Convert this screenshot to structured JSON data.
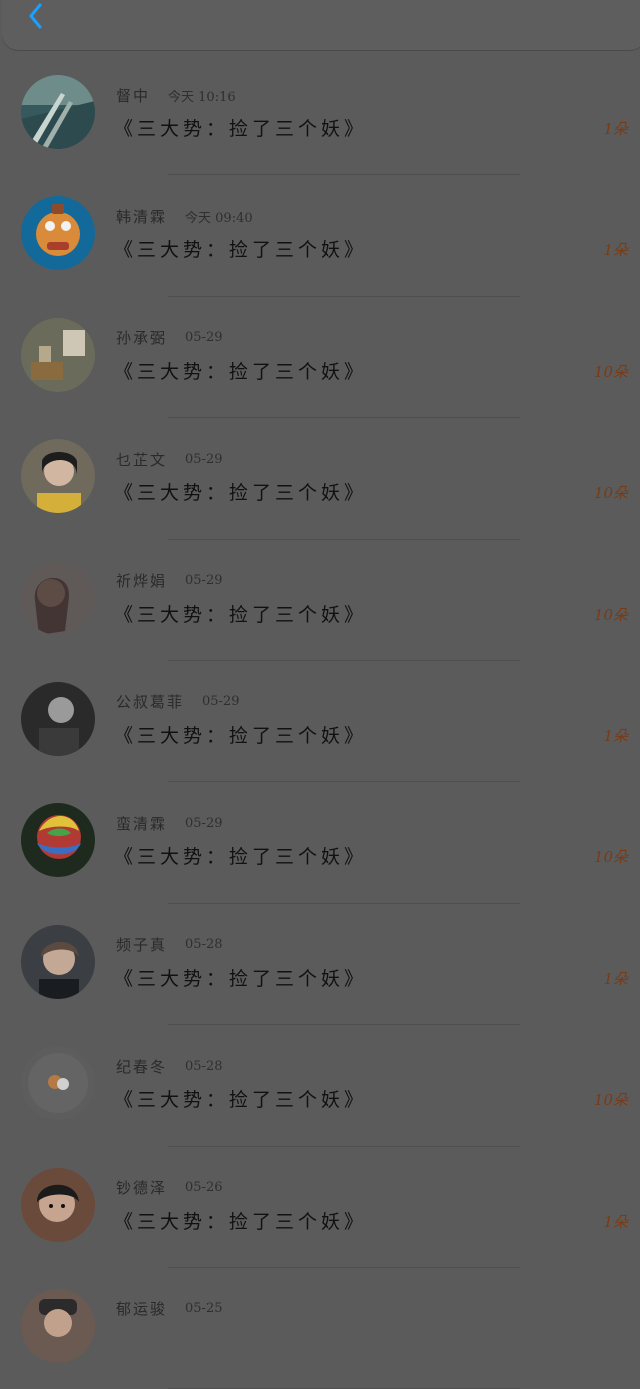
{
  "header": {
    "back_icon": "chevron-left-icon"
  },
  "accent_color": "#1aa1ff",
  "count_color": "#7a3b14",
  "items": [
    {
      "name": "督中",
      "time": "今天 10:16",
      "title": "《三大势：捡了三个妖》",
      "count": "1朵",
      "avatar_icon": "abstract-landscape-avatar"
    },
    {
      "name": "韩清霖",
      "time": "今天 09:40",
      "title": "《三大势：捡了三个妖》",
      "count": "1朵",
      "avatar_icon": "cartoon-robot-avatar"
    },
    {
      "name": "孙承弼",
      "time": "05-29",
      "title": "《三大势：捡了三个妖》",
      "count": "10朵",
      "avatar_icon": "photo-frame-avatar"
    },
    {
      "name": "乜芷文",
      "time": "05-29",
      "title": "《三大势：捡了三个妖》",
      "count": "10朵",
      "avatar_icon": "girl-portrait-avatar"
    },
    {
      "name": "祈烨娟",
      "time": "05-29",
      "title": "《三大势：捡了三个妖》",
      "count": "10朵",
      "avatar_icon": "woman-portrait-avatar"
    },
    {
      "name": "公叔葛菲",
      "time": "05-29",
      "title": "《三大势：捡了三个妖》",
      "count": "1朵",
      "avatar_icon": "grayscale-portrait-avatar"
    },
    {
      "name": "蛮清霖",
      "time": "05-29",
      "title": "《三大势：捡了三个妖》",
      "count": "10朵",
      "avatar_icon": "rainbow-rose-avatar"
    },
    {
      "name": "频子真",
      "time": "05-28",
      "title": "《三大势：捡了三个妖》",
      "count": "1朵",
      "avatar_icon": "man-portrait-avatar"
    },
    {
      "name": "纪春冬",
      "time": "05-28",
      "title": "《三大势：捡了三个妖》",
      "count": "10朵",
      "avatar_icon": "cute-sticker-avatar"
    },
    {
      "name": "钞德泽",
      "time": "05-26",
      "title": "《三大势：捡了三个妖》",
      "count": "1朵",
      "avatar_icon": "boy-portrait-avatar"
    },
    {
      "name": "郁运骏",
      "time": "05-25",
      "title": "",
      "count": "",
      "avatar_icon": "hat-portrait-avatar"
    }
  ]
}
